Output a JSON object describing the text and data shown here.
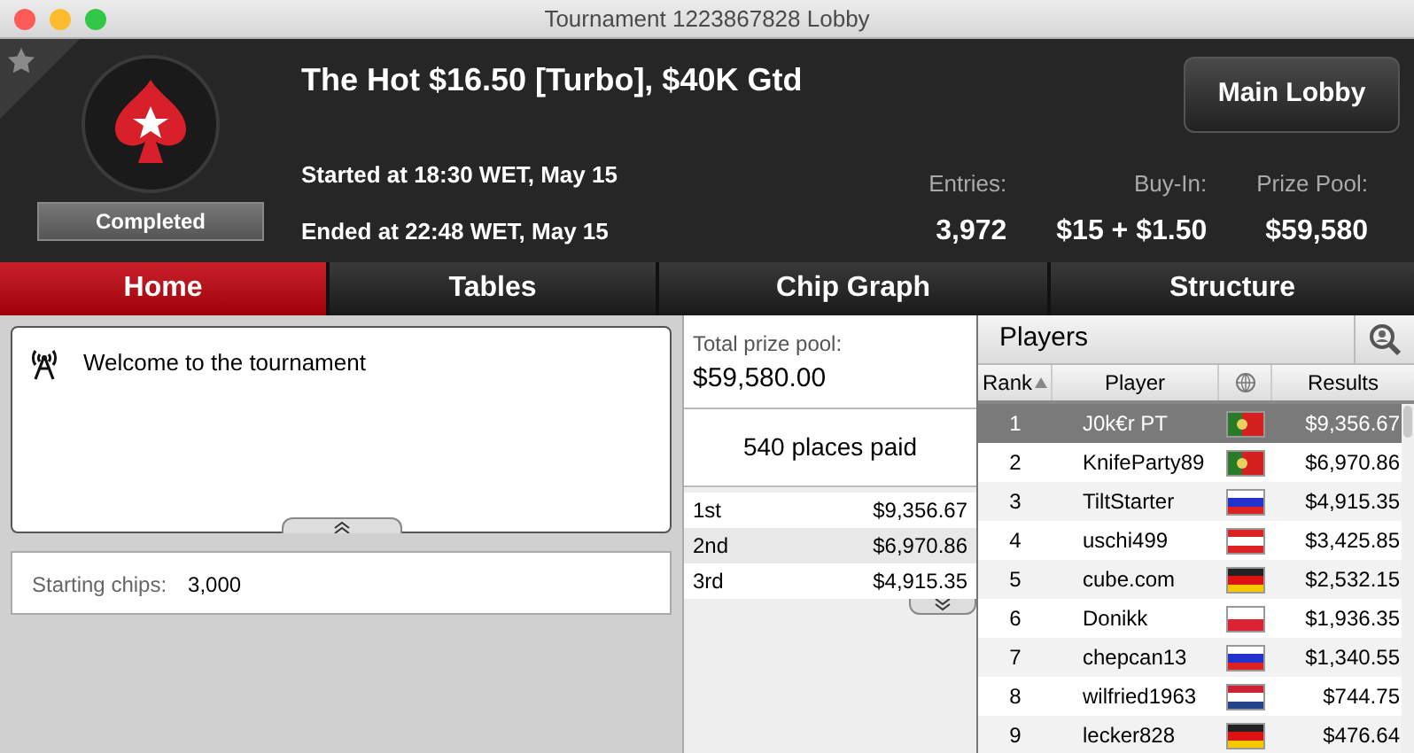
{
  "window": {
    "title": "Tournament 1223867828 Lobby"
  },
  "header": {
    "favorite": false,
    "title": "The Hot $16.50 [Turbo], $40K Gtd",
    "status": "Completed",
    "started": "Started at 18:30 WET, May 15",
    "ended": "Ended at 22:48 WET, May 15",
    "main_lobby_button": "Main Lobby",
    "stats": [
      {
        "label": "Entries:",
        "value": "3,972"
      },
      {
        "label": "Buy-In:",
        "value": "$15 + $1.50"
      },
      {
        "label": "Prize Pool:",
        "value": "$59,580"
      }
    ]
  },
  "tabs": [
    {
      "label": "Home",
      "selected": true
    },
    {
      "label": "Tables",
      "selected": false
    },
    {
      "label": "Chip Graph",
      "selected": false
    },
    {
      "label": "Structure",
      "selected": false
    }
  ],
  "news": {
    "message": "Welcome to the tournament"
  },
  "info": {
    "label": "Starting chips:",
    "value": "3,000"
  },
  "prizes": {
    "label": "Total prize pool:",
    "total": "$59,580.00",
    "places": "540 places paid",
    "rows": [
      {
        "place": "1st",
        "amount": "$9,356.67"
      },
      {
        "place": "2nd",
        "amount": "$6,970.86"
      },
      {
        "place": "3rd",
        "amount": "$4,915.35"
      }
    ]
  },
  "players": {
    "title": "Players",
    "columns": [
      "Rank",
      "Player",
      "Results"
    ],
    "rows": [
      {
        "rank": "1",
        "name": "J0k€r PT",
        "kind": "portugal",
        "result": "$9,356.67",
        "selected": true
      },
      {
        "rank": "2",
        "name": "KnifeParty89",
        "kind": "portugal",
        "result": "$6,970.86",
        "selected": false
      },
      {
        "rank": "3",
        "name": "TiltStarter",
        "kind": "russia",
        "result": "$4,915.35",
        "selected": false
      },
      {
        "rank": "4",
        "name": "uschi499",
        "kind": "austria",
        "result": "$3,425.85",
        "selected": false
      },
      {
        "rank": "5",
        "name": "cube.com",
        "kind": "germany",
        "result": "$2,532.15",
        "selected": false
      },
      {
        "rank": "6",
        "name": "Donikk",
        "kind": "poland",
        "result": "$1,936.35",
        "selected": false
      },
      {
        "rank": "7",
        "name": "chepcan13",
        "kind": "russia",
        "result": "$1,340.55",
        "selected": false
      },
      {
        "rank": "8",
        "name": "wilfried1963",
        "kind": "netherlands",
        "result": "$744.75",
        "selected": false
      },
      {
        "rank": "9",
        "name": "lecker828",
        "kind": "germany",
        "result": "$476.64",
        "selected": false
      }
    ]
  }
}
